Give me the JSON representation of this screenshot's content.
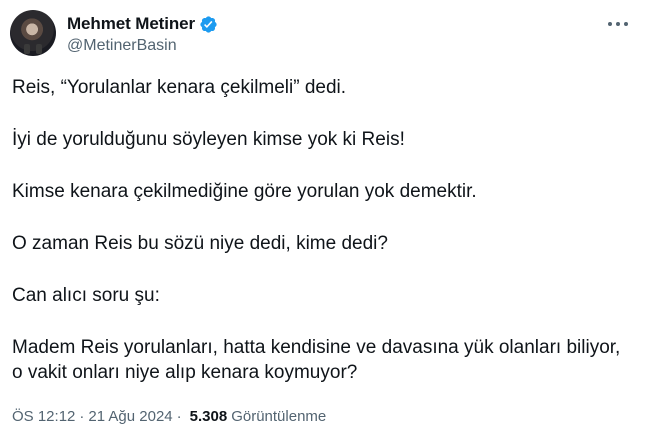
{
  "author": {
    "display_name": "Mehmet Metiner",
    "handle": "@MetinerBasin",
    "verified": true,
    "verified_color": "#1d9bf0"
  },
  "more_icon": "more-horizontal-icon",
  "tweet": {
    "paragraphs": [
      "Reis, “Yorulanlar kenara çekilmeli” dedi.",
      "İyi de yorulduğunu söyleyen kimse yok ki Reis!",
      "Kimse kenara çekilmediğine göre yorulan yok demektir.",
      "O zaman Reis bu sözü niye dedi, kime dedi?",
      "Can alıcı soru şu:",
      "Madem Reis yorulanları, hatta kendisine ve davasına yük olanları biliyor,\no vakit onları niye alıp kenara koymuyor?"
    ]
  },
  "meta": {
    "time": "ÖS 12:12",
    "separator": "·",
    "date": "21 Ağu 2024",
    "separator2": "·",
    "views_count": "5.308",
    "views_label": "Görüntülenme"
  }
}
